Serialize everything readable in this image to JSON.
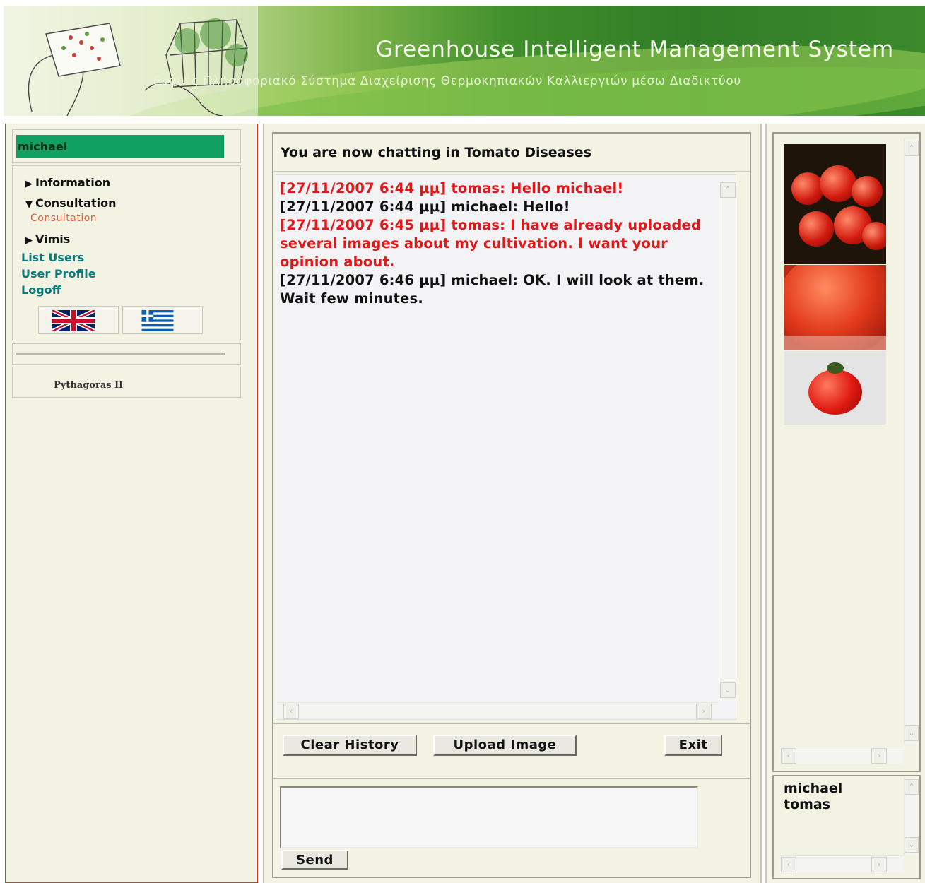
{
  "banner": {
    "title": "Greenhouse Intelligent Management System",
    "subtitle": "Ευφυές Πληροφοριακό Σύστημα Διαχείρισης Θερμοκηπιακών Καλλιεργιών μέσω Διαδικτύου"
  },
  "sidebar": {
    "username": "michael",
    "menu": {
      "information": "Information",
      "consultation": "Consultation",
      "consultation_sub": "Consultation",
      "vimis": "Vimis",
      "list_users": "List Users",
      "user_profile": "User Profile",
      "logoff": "Logoff"
    },
    "languages": [
      "flag-uk-icon",
      "flag-greece-icon"
    ],
    "footer": "Pythagoras II"
  },
  "chat": {
    "header": "You are now chatting in Tomato Diseases",
    "messages": [
      {
        "text": "[27/11/2007 6:44 μμ] tomas: Hello michael!",
        "color": "#e01818"
      },
      {
        "text": "[27/11/2007 6:44 μμ] michael: Hello!",
        "color": "#111111"
      },
      {
        "text": "[27/11/2007 6:45 μμ] tomas: I have already uploaded several images about my cultivation. I want your opinion about.",
        "color": "#e01818"
      },
      {
        "text": "[27/11/2007 6:46 μμ] michael: OK. I will look at them. Wait few minutes.",
        "color": "#111111"
      }
    ],
    "buttons": {
      "clear_history": "Clear History",
      "upload_image": "Upload Image",
      "exit": "Exit",
      "send": "Send"
    },
    "input_value": ""
  },
  "images_panel": {
    "images": [
      "tomato-cluster-image",
      "tomato-closeup-image",
      "tomato-single-image"
    ]
  },
  "online_users": [
    "michael",
    "tomas"
  ],
  "colors": {
    "banner_green": "#3f8f2c",
    "username_bg": "#10a060",
    "message_red": "#e01818",
    "link_teal": "#0a7a7a",
    "panel_bg": "#f2f3e3"
  }
}
